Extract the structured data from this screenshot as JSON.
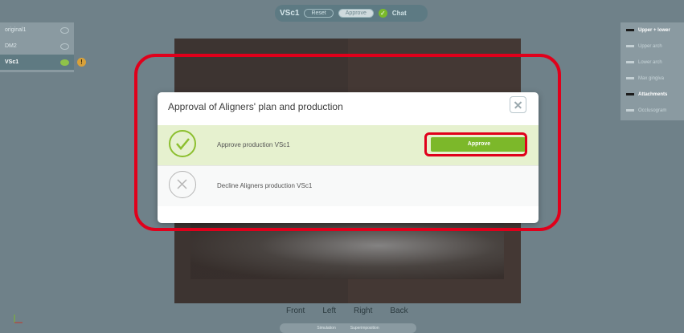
{
  "topbar": {
    "title": "VSc1",
    "reset_label": "Reset",
    "approve_label": "Approve",
    "chat_label": "Chat",
    "status_icon": "check-circle-icon"
  },
  "left_panel": {
    "items": [
      {
        "label": "original1",
        "selected": false
      },
      {
        "label": "DM2",
        "selected": false
      },
      {
        "label": "VSc1",
        "selected": true
      }
    ],
    "warning_icon": "warning-icon"
  },
  "right_panel": {
    "items": [
      {
        "label": "Upper + lower",
        "icon": "upper-lower-icon",
        "bold": true
      },
      {
        "label": "Upper arch",
        "icon": "upper-arch-icon",
        "bold": false
      },
      {
        "label": "Lower arch",
        "icon": "lower-arch-icon",
        "bold": false
      },
      {
        "label": "Max gingiva",
        "icon": "gingiva-icon",
        "bold": false
      },
      {
        "label": "Attachments",
        "icon": "attachments-icon",
        "bold": true
      },
      {
        "label": "Occlusogram",
        "icon": "occlusogram-icon",
        "bold": false
      }
    ]
  },
  "modal": {
    "title": "Approval of Aligners' plan and production",
    "close_icon": "close-icon",
    "options": [
      {
        "label": "Approve production VSc1",
        "icon": "check-circle-icon",
        "button_label": "Approve"
      },
      {
        "label": "Decline Aligners production VSc1",
        "icon": "x-circle-icon"
      }
    ]
  },
  "bottom_nav": {
    "views": [
      "Front",
      "Left",
      "Right",
      "Back"
    ],
    "tabs": [
      "Simulation",
      "Superimposition"
    ]
  },
  "colors": {
    "accent_green": "#7cb82a",
    "highlight_red": "#e0001b",
    "background": "#6f8189"
  }
}
